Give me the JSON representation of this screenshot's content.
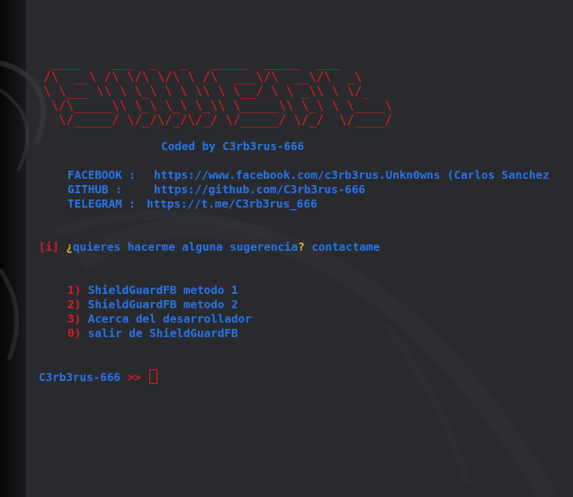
{
  "banner": {
    "art": "  ____    ___  _   _   _____  _____  ___ \n /\\  __\\ /\\ \\/\\ \\/\\ \\ /\\  ___\\/\\  __\\/\\  _\\\n \\ \\___ \\\\ \\ \\_\\ \\ \\ \\\\ \\ \\__/ \\ \\ _\\\\ \\ \\/_\n  \\/\\_____\\\\ \\_\\ \\_\\ \\_\\\\ \\_____\\\\ \\_\\ \\ \\____\\\n   \\/_____/ \\/_/\\/_/\\/_/ \\/_____/ \\/_/  \\/____/"
  },
  "credits": {
    "coded_by": "Coded by C3rb3rus-666",
    "facebook_label": "FACEBOOK :",
    "facebook_url": "https://www.facebook.com/c3rb3rus.Unkn0wns (Carlos Sanchez",
    "github_label": "GITHUB :",
    "github_url": "https://github.com/C3rb3rus-666",
    "telegram_label": "TELEGRAM :",
    "telegram_url": "https://t.me/C3rb3rus_666"
  },
  "info": {
    "tag": "[i]",
    "open_q": "¿",
    "question": "quieres hacerme alguna sugerencia",
    "close_q": "?",
    "contact": "contactame"
  },
  "menu": [
    {
      "num": "1)",
      "label": "ShieldGuardFB metodo 1"
    },
    {
      "num": "2)",
      "label": "ShieldGuardFB metodo 2"
    },
    {
      "num": "3)",
      "label": "Acerca del desarrollador"
    },
    {
      "num": "0)",
      "label": "salir de ShieldGuardFB"
    }
  ],
  "prompt": {
    "user": "C3rb3rus-666",
    "arrow": ">>"
  },
  "colors": {
    "background": "#282a2e",
    "text_blue": "#2a74e8",
    "accent_red": "#e01c1c",
    "highlight_yellow": "#e0b92a"
  }
}
